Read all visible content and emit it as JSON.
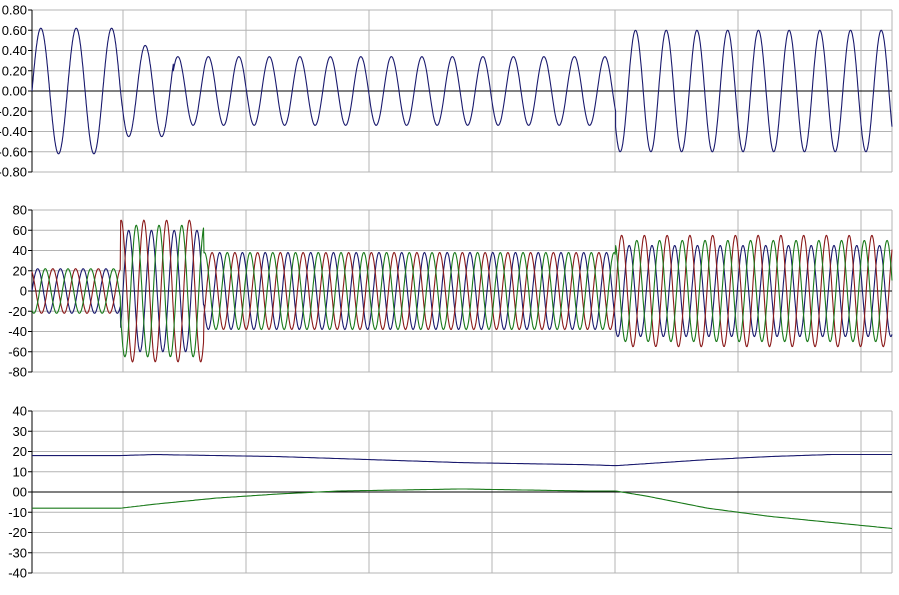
{
  "chart_data": [
    {
      "type": "line",
      "title": "",
      "xlabel": "",
      "ylabel": "",
      "xlim": [
        0,
        7
      ],
      "ylim": [
        -0.8,
        0.8
      ],
      "grid": true,
      "y_ticks": [
        "0.80",
        "0.60",
        "0.40",
        "0.20",
        "0.00",
        "-0.20",
        "-0.40",
        "-0.60",
        "-0.80"
      ],
      "series": [
        {
          "color": "#1a1a6e",
          "segments": [
            {
              "x0": 0.0,
              "x1": 0.72,
              "amplitude": 0.62,
              "cycles": 2.5,
              "phase": 0
            },
            {
              "x0": 0.72,
              "x1": 1.15,
              "amplitude": 0.45,
              "cycles": 1.6,
              "phase": 0
            },
            {
              "x0": 1.15,
              "x1": 4.75,
              "amplitude": 0.34,
              "cycles": 14.5,
              "phase": 0
            },
            {
              "x0": 4.75,
              "x1": 7.0,
              "amplitude": 0.6,
              "cycles": 9.0,
              "phase": 0
            }
          ]
        }
      ]
    },
    {
      "type": "line",
      "title": "",
      "xlabel": "",
      "ylabel": "",
      "xlim": [
        0,
        7
      ],
      "ylim": [
        -80,
        80
      ],
      "grid": true,
      "y_ticks": [
        "80",
        "60",
        "40",
        "20",
        "0",
        "-20",
        "-40",
        "-60",
        "-80"
      ],
      "series": [
        {
          "color": "#1a1a6e",
          "phase_deg": 0,
          "segments": [
            {
              "x0": 0.0,
              "x1": 0.72,
              "amplitude": 22
            },
            {
              "x0": 0.72,
              "x1": 1.4,
              "amplitude": 60
            },
            {
              "x0": 1.4,
              "x1": 4.75,
              "amplitude": 38
            },
            {
              "x0": 4.75,
              "x1": 7.0,
              "amplitude": 45
            }
          ]
        },
        {
          "color": "#8b1a1a",
          "phase_deg": 120,
          "segments": [
            {
              "x0": 0.0,
              "x1": 0.72,
              "amplitude": 22
            },
            {
              "x0": 0.72,
              "x1": 1.4,
              "amplitude": 70
            },
            {
              "x0": 1.4,
              "x1": 4.75,
              "amplitude": 38
            },
            {
              "x0": 4.75,
              "x1": 7.0,
              "amplitude": 55
            }
          ]
        },
        {
          "color": "#1a7a1a",
          "phase_deg": 240,
          "segments": [
            {
              "x0": 0.0,
              "x1": 0.72,
              "amplitude": 22
            },
            {
              "x0": 0.72,
              "x1": 1.4,
              "amplitude": 65
            },
            {
              "x0": 1.4,
              "x1": 4.75,
              "amplitude": 38
            },
            {
              "x0": 4.75,
              "x1": 7.0,
              "amplitude": 50
            }
          ]
        }
      ],
      "cycles_per_unit": 5.4
    },
    {
      "type": "line",
      "title": "",
      "xlabel": "",
      "ylabel": "",
      "xlim": [
        0,
        7
      ],
      "ylim": [
        -40,
        40
      ],
      "grid": true,
      "y_ticks": [
        "40",
        "30",
        "20",
        "10",
        "00",
        "-10",
        "-20",
        "-30",
        "-40"
      ],
      "series": [
        {
          "color": "#1a1a6e",
          "x": [
            0.0,
            0.72,
            1.0,
            1.5,
            2.0,
            2.5,
            3.0,
            3.5,
            4.0,
            4.5,
            4.75,
            5.0,
            5.5,
            6.0,
            6.5,
            7.0
          ],
          "y": [
            18,
            18,
            18.5,
            18,
            17.5,
            16.5,
            15.5,
            14.5,
            14,
            13.5,
            13,
            14,
            16,
            17.5,
            18.5,
            18.5
          ]
        },
        {
          "color": "#1a7a1a",
          "x": [
            0.0,
            0.72,
            1.0,
            1.5,
            2.0,
            2.5,
            3.0,
            3.5,
            4.0,
            4.5,
            4.75,
            5.0,
            5.5,
            6.0,
            6.5,
            7.0
          ],
          "y": [
            -8,
            -8,
            -6,
            -3,
            -1,
            0.5,
            1,
            1.5,
            1,
            0.5,
            0.5,
            -2,
            -8,
            -12,
            -15,
            -18
          ]
        }
      ]
    }
  ]
}
